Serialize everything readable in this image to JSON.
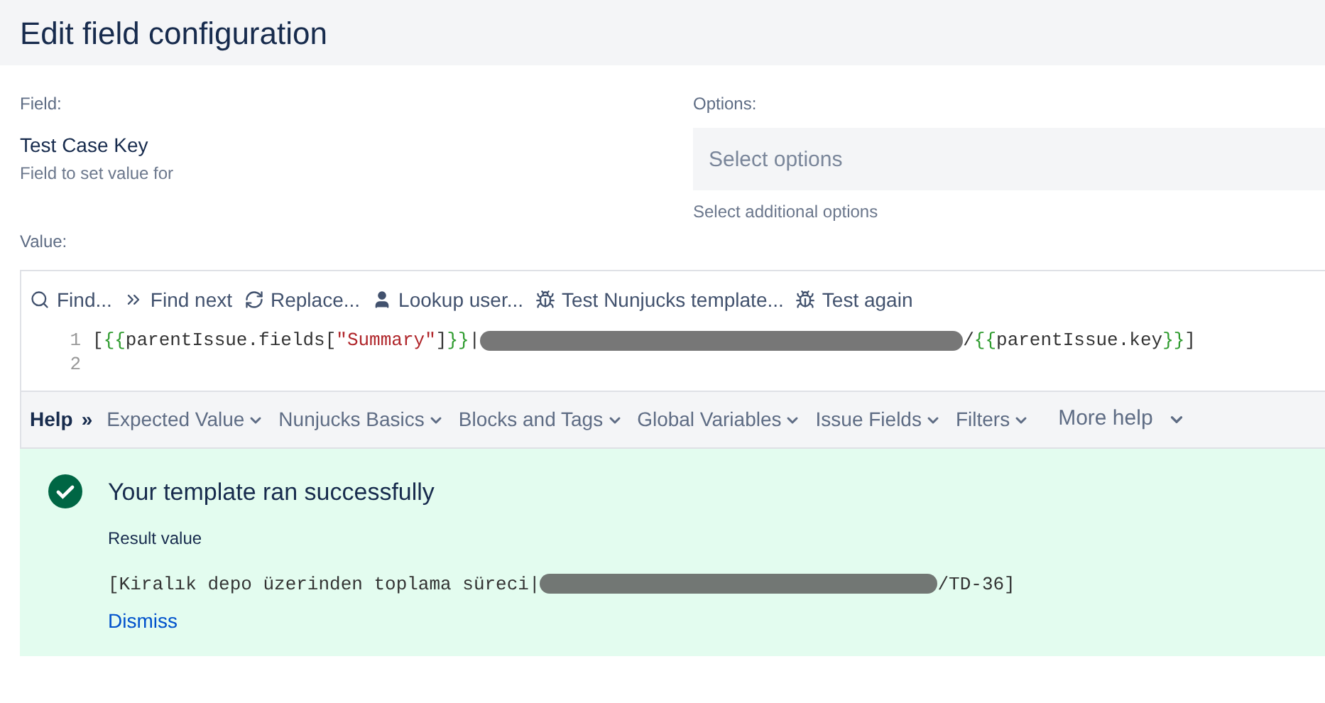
{
  "header": {
    "title": "Edit field configuration"
  },
  "field": {
    "label": "Field:",
    "name": "Test Case Key",
    "description": "Field to set value for"
  },
  "options": {
    "label": "Options:",
    "placeholder": "Select options",
    "hint": "Select additional options"
  },
  "value_label": "Value:",
  "toolbar": [
    {
      "kind": "search",
      "label": "Find..."
    },
    {
      "kind": "next",
      "label": "Find next"
    },
    {
      "kind": "replace",
      "label": "Replace..."
    },
    {
      "kind": "user",
      "label": "Lookup user..."
    },
    {
      "kind": "bug",
      "label": "Test Nunjucks template..."
    },
    {
      "kind": "bug",
      "label": "Test again"
    }
  ],
  "code_lines": [
    {
      "number": "1",
      "tokens": [
        {
          "kind": "plain",
          "text": "["
        },
        {
          "kind": "brace",
          "text": "{{"
        },
        {
          "kind": "plain",
          "text": "parentIssue.fields["
        },
        {
          "kind": "string",
          "text": "\"Summary\""
        },
        {
          "kind": "plain",
          "text": "]"
        },
        {
          "kind": "brace",
          "text": "}}"
        },
        {
          "kind": "plain",
          "text": "|"
        },
        {
          "kind": "redacted"
        },
        {
          "kind": "plain",
          "text": "/"
        },
        {
          "kind": "brace",
          "text": "{{"
        },
        {
          "kind": "plain",
          "text": "parentIssue.key"
        },
        {
          "kind": "brace",
          "text": "}}"
        },
        {
          "kind": "plain",
          "text": "]"
        }
      ]
    },
    {
      "number": "2"
    }
  ],
  "help_bar": {
    "label": "Help",
    "arrows": "»",
    "menus": [
      "Expected Value",
      "Nunjucks Basics",
      "Blocks and Tags",
      "Global Variables",
      "Issue Fields",
      "Filters"
    ],
    "more": "More help"
  },
  "result": {
    "title": "Your template ran successfully",
    "label": "Result value",
    "parts": [
      {
        "kind": "plain",
        "text": "[Kiralık depo üzerinden toplama süreci|"
      },
      {
        "kind": "redacted"
      },
      {
        "kind": "plain",
        "text": "/TD-36]"
      }
    ],
    "dismiss": "Dismiss"
  }
}
